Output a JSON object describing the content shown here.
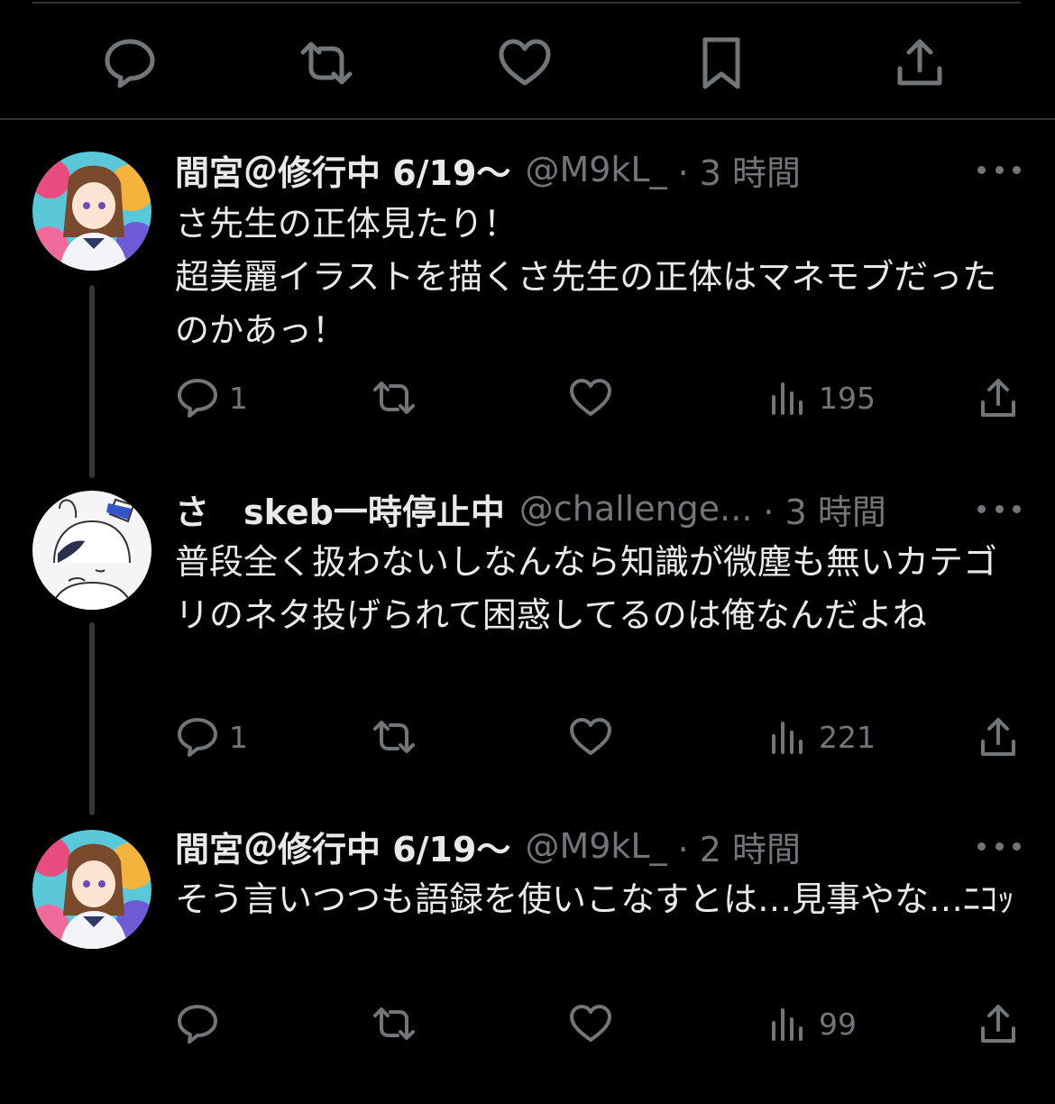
{
  "top_actions": [
    "reply-icon",
    "retweet-icon",
    "like-icon",
    "bookmark-icon",
    "share-icon"
  ],
  "tweets": [
    {
      "name": "間宮＠修行中 6/19〜",
      "handle": "@M9kL_",
      "time": "· 3 時間",
      "text": "さ先生の正体見たり！\n超美麗イラストを描くさ先生の正体はマネモブだったのかあっ！",
      "replies": "1",
      "views": "195",
      "avatar": "character-avatar-colorful"
    },
    {
      "name": "さ　skeb一時停止中",
      "handle": "@challenge...",
      "time": "· 3 時間",
      "text": "普段全く扱わないしなんなら知識が微塵も無いカテゴリのネタ投げられて困惑してるのは俺なんだよね",
      "replies": "1",
      "views": "221",
      "avatar": "character-avatar-sketch"
    },
    {
      "name": "間宮＠修行中 6/19〜",
      "handle": "@M9kL_",
      "time": "· 2 時間",
      "text": "そう言いつつも語録を使いこなすとは…見事やな…ﾆｺｯ",
      "replies": "",
      "views": "99",
      "avatar": "character-avatar-colorful"
    }
  ],
  "colors": {
    "background": "#000000",
    "text": "#e7e9ea",
    "muted": "#71767b",
    "divider": "#2f3336"
  }
}
